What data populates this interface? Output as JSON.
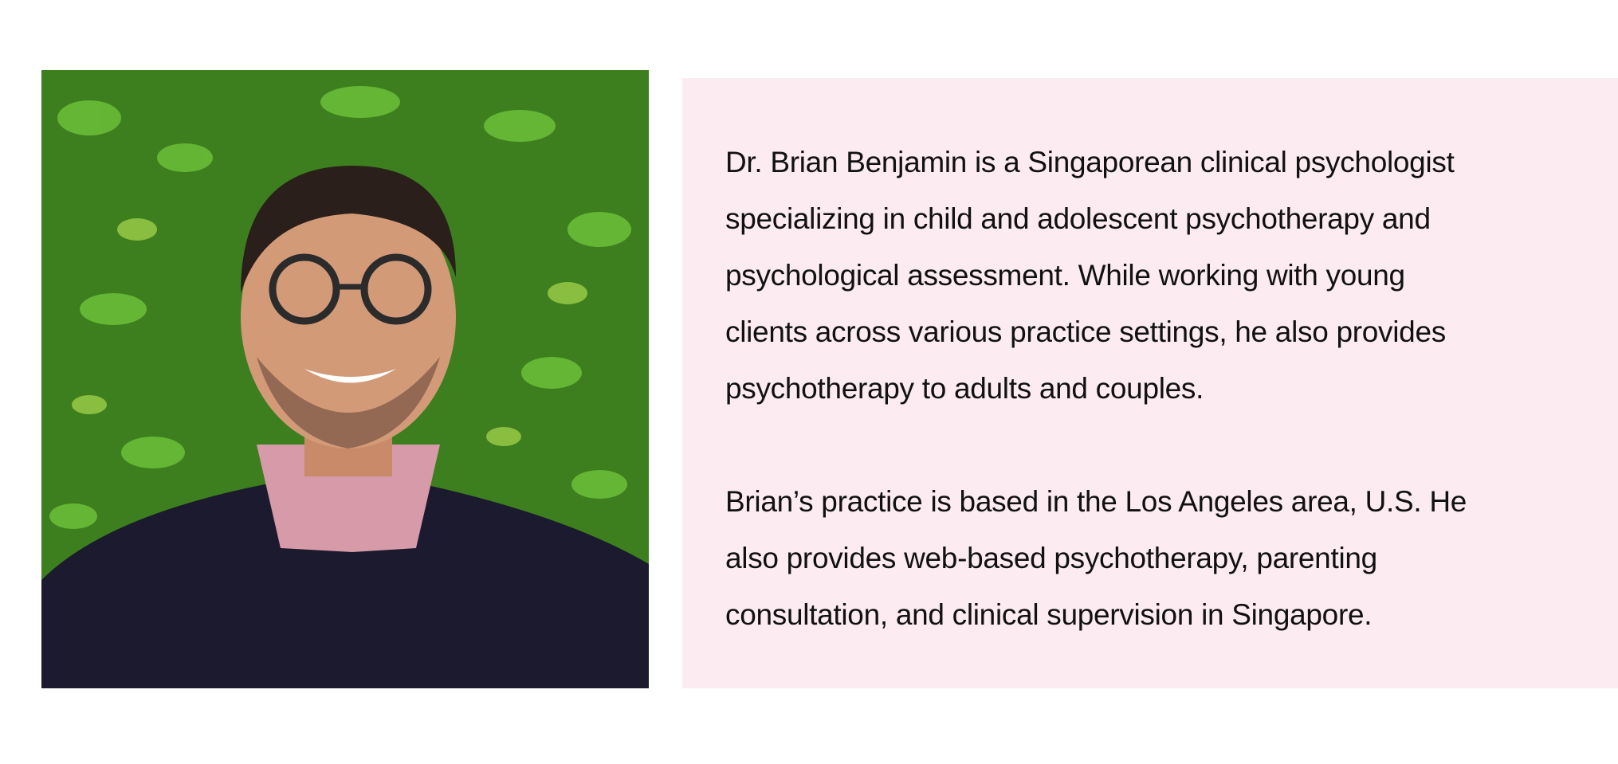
{
  "photo": {
    "alt": "Portrait of Dr. Brian Benjamin"
  },
  "bio": {
    "paragraphs": [
      {
        "lines": [
          "Dr. Brian Benjamin is a Singaporean clinical psychologist",
          "specializing in child and adolescent psychotherapy and",
          "psychological assessment. While working with young",
          "clients across various practice settings, he also provides",
          "psychotherapy to adults and couples."
        ]
      },
      {
        "lines": [
          "Brian’s practice is based in the Los Angeles area, U.S. He",
          "also provides web-based psychotherapy, parenting",
          "consultation, and clinical supervision in Singapore."
        ]
      }
    ]
  },
  "colors": {
    "panel_background": "#fcebf1",
    "text": "#111111"
  }
}
